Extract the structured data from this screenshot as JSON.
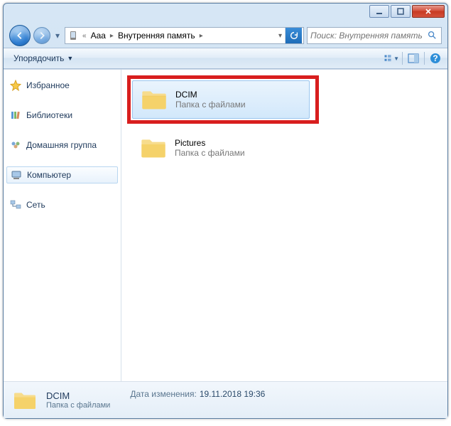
{
  "titlebar": {},
  "nav": {
    "back": true,
    "forward": false
  },
  "breadcrumb": {
    "root_icon": "device-icon",
    "items": [
      "Aaa",
      "Внутренняя память"
    ]
  },
  "search": {
    "placeholder": "Поиск: Внутренняя память"
  },
  "toolbar": {
    "organize": "Упорядочить"
  },
  "sidebar": {
    "items": [
      {
        "icon": "star",
        "label": "Избранное"
      },
      {
        "icon": "library",
        "label": "Библиотеки"
      },
      {
        "icon": "homegroup",
        "label": "Домашняя группа"
      },
      {
        "icon": "computer",
        "label": "Компьютер",
        "selected": true
      },
      {
        "icon": "network",
        "label": "Сеть"
      }
    ]
  },
  "content": {
    "folders": [
      {
        "name": "DCIM",
        "desc": "Папка с файлами",
        "selected": true,
        "highlighted": true
      },
      {
        "name": "Pictures",
        "desc": "Папка с файлами",
        "selected": false,
        "highlighted": false
      }
    ]
  },
  "details": {
    "name": "DCIM",
    "desc": "Папка с файлами",
    "date_label": "Дата изменения:",
    "date_value": "19.11.2018 19:36"
  }
}
